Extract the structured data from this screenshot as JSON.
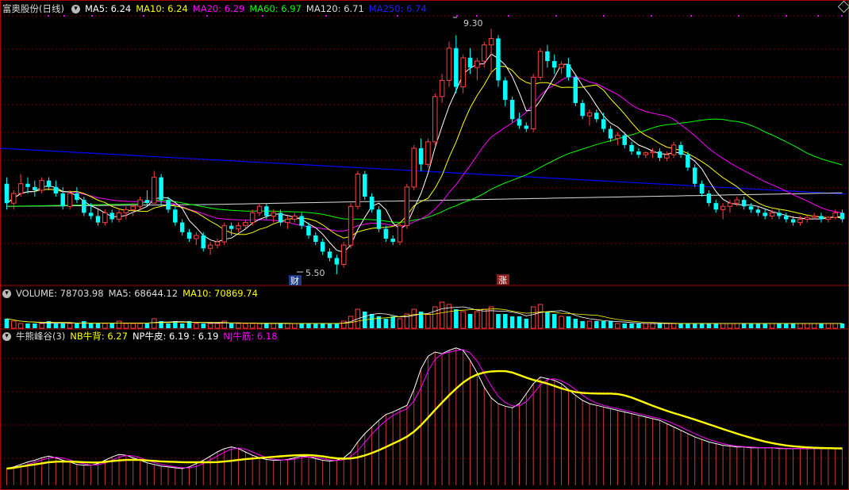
{
  "colors": {
    "up": "#ff4040",
    "down": "#00ffff",
    "ma5": "#ffffff",
    "ma10": "#ffff00",
    "ma20": "#ff00ff",
    "ma60": "#00ff00",
    "ma120": "#dddddd",
    "ma250": "#0000ff",
    "grid": "#7a0000",
    "nb": "#ffff00",
    "np": "#ffffff",
    "nj": "#ff00ff"
  },
  "main_legend": {
    "title": "富奥股份(日线)",
    "items": [
      {
        "text": "MA5: 6.24",
        "color": "#ffffff"
      },
      {
        "text": "MA10: 6.24",
        "color": "#ffff00"
      },
      {
        "text": "MA20: 6.29",
        "color": "#ff00ff"
      },
      {
        "text": "MA60: 6.97",
        "color": "#00ff00"
      },
      {
        "text": "MA120: 6.71",
        "color": "#dddddd"
      },
      {
        "text": "MA250: 6.74",
        "color": "#2020ff"
      }
    ]
  },
  "volume_legend": {
    "items": [
      {
        "text": "VOLUME: 78703.98",
        "color": "#dddddd"
      },
      {
        "text": "MA5: 68644.12",
        "color": "#dddddd"
      },
      {
        "text": "MA10: 70869.74",
        "color": "#ffff00"
      }
    ]
  },
  "osc_legend": {
    "items": [
      {
        "text": "牛熊峰谷(3)",
        "color": "#dddddd"
      },
      {
        "text": "NB牛背: 6.27",
        "color": "#ffff00"
      },
      {
        "text": "NP牛皮: 6.19 : 6.19",
        "color": "#ffffff"
      },
      {
        "text": "NJ牛筋: 6.18",
        "color": "#ff00ff"
      }
    ]
  },
  "annotations": {
    "high_label": "9.30",
    "low_label": "5.50",
    "badge_cai": "财",
    "badge_zhang": "涨"
  },
  "chart_data": [
    {
      "type": "candlestick",
      "title": "富奥股份(日线)",
      "ylim": [
        5.35,
        9.5
      ],
      "high": 9.3,
      "low": 5.5,
      "ohlc": [
        [
          6.9,
          7.0,
          6.5,
          6.6
        ],
        [
          6.6,
          6.8,
          6.5,
          6.75
        ],
        [
          6.75,
          7.05,
          6.7,
          6.9
        ],
        [
          6.9,
          7.0,
          6.75,
          6.85
        ],
        [
          6.85,
          6.95,
          6.7,
          6.8
        ],
        [
          6.8,
          7.0,
          6.75,
          6.95
        ],
        [
          6.95,
          7.0,
          6.8,
          6.85
        ],
        [
          6.85,
          6.95,
          6.7,
          6.75
        ],
        [
          6.75,
          6.85,
          6.5,
          6.55
        ],
        [
          6.55,
          6.8,
          6.5,
          6.75
        ],
        [
          6.75,
          6.85,
          6.6,
          6.65
        ],
        [
          6.65,
          6.7,
          6.4,
          6.45
        ],
        [
          6.45,
          6.6,
          6.35,
          6.4
        ],
        [
          6.4,
          6.5,
          6.25,
          6.3
        ],
        [
          6.3,
          6.5,
          6.25,
          6.45
        ],
        [
          6.45,
          6.5,
          6.3,
          6.35
        ],
        [
          6.35,
          6.5,
          6.3,
          6.45
        ],
        [
          6.45,
          6.55,
          6.35,
          6.5
        ],
        [
          6.5,
          6.6,
          6.4,
          6.55
        ],
        [
          6.55,
          6.7,
          6.5,
          6.65
        ],
        [
          6.65,
          6.8,
          6.55,
          6.6
        ],
        [
          6.6,
          7.1,
          6.6,
          7.0
        ],
        [
          7.0,
          7.05,
          6.55,
          6.65
        ],
        [
          6.65,
          6.7,
          6.45,
          6.5
        ],
        [
          6.5,
          6.55,
          6.25,
          6.3
        ],
        [
          6.3,
          6.35,
          6.1,
          6.15
        ],
        [
          6.15,
          6.2,
          6.0,
          6.05
        ],
        [
          6.05,
          6.15,
          5.95,
          6.1
        ],
        [
          6.1,
          6.15,
          5.85,
          5.9
        ],
        [
          5.9,
          6.0,
          5.8,
          5.95
        ],
        [
          5.95,
          6.05,
          5.9,
          6.0
        ],
        [
          6.0,
          6.3,
          5.95,
          6.25
        ],
        [
          6.25,
          6.3,
          6.1,
          6.2
        ],
        [
          6.2,
          6.3,
          6.15,
          6.25
        ],
        [
          6.25,
          6.35,
          6.2,
          6.3
        ],
        [
          6.3,
          6.5,
          6.25,
          6.45
        ],
        [
          6.45,
          6.6,
          6.4,
          6.55
        ],
        [
          6.55,
          6.6,
          6.35,
          6.4
        ],
        [
          6.4,
          6.5,
          6.3,
          6.45
        ],
        [
          6.45,
          6.5,
          6.25,
          6.3
        ],
        [
          6.3,
          6.4,
          6.2,
          6.35
        ],
        [
          6.35,
          6.45,
          6.3,
          6.4
        ],
        [
          6.4,
          6.45,
          6.2,
          6.25
        ],
        [
          6.25,
          6.3,
          6.05,
          6.1
        ],
        [
          6.1,
          6.15,
          5.95,
          6.0
        ],
        [
          6.0,
          6.05,
          5.8,
          5.85
        ],
        [
          5.85,
          5.9,
          5.7,
          5.75
        ],
        [
          5.75,
          5.8,
          5.5,
          5.65
        ],
        [
          5.65,
          6.0,
          5.6,
          5.95
        ],
        [
          5.95,
          6.6,
          5.9,
          6.55
        ],
        [
          6.55,
          7.1,
          6.5,
          7.05
        ],
        [
          7.05,
          7.1,
          6.65,
          6.7
        ],
        [
          6.7,
          6.75,
          6.45,
          6.5
        ],
        [
          6.5,
          6.55,
          6.15,
          6.2
        ],
        [
          6.2,
          6.25,
          6.0,
          6.05
        ],
        [
          6.05,
          6.1,
          5.95,
          6.0
        ],
        [
          6.0,
          6.3,
          5.95,
          6.25
        ],
        [
          6.25,
          6.9,
          6.2,
          6.85
        ],
        [
          6.85,
          7.5,
          6.8,
          7.45
        ],
        [
          7.45,
          7.6,
          7.1,
          7.2
        ],
        [
          7.2,
          7.6,
          7.15,
          7.55
        ],
        [
          7.55,
          8.3,
          7.5,
          8.25
        ],
        [
          8.25,
          8.6,
          8.15,
          8.5
        ],
        [
          8.5,
          9.1,
          8.4,
          9.0
        ],
        [
          9.0,
          9.2,
          8.3,
          8.4
        ],
        [
          8.4,
          8.9,
          8.3,
          8.85
        ],
        [
          8.85,
          9.0,
          8.6,
          8.7
        ],
        [
          8.7,
          8.85,
          8.5,
          8.8
        ],
        [
          8.8,
          9.1,
          8.7,
          9.05
        ],
        [
          9.05,
          9.3,
          8.6,
          9.15
        ],
        [
          9.15,
          9.2,
          8.4,
          8.5
        ],
        [
          8.5,
          8.55,
          8.1,
          8.2
        ],
        [
          8.2,
          8.25,
          7.85,
          7.9
        ],
        [
          7.9,
          8.0,
          7.75,
          7.8
        ],
        [
          7.8,
          7.85,
          7.7,
          7.75
        ],
        [
          7.75,
          8.6,
          7.7,
          8.55
        ],
        [
          8.55,
          9.0,
          8.5,
          8.95
        ],
        [
          8.95,
          9.05,
          8.7,
          8.8
        ],
        [
          8.8,
          8.9,
          8.6,
          8.7
        ],
        [
          8.7,
          8.8,
          8.6,
          8.75
        ],
        [
          8.75,
          8.85,
          8.5,
          8.55
        ],
        [
          8.55,
          8.6,
          8.1,
          8.15
        ],
        [
          8.15,
          8.2,
          7.9,
          7.95
        ],
        [
          7.95,
          8.05,
          7.8,
          8.0
        ],
        [
          8.0,
          8.05,
          7.85,
          7.9
        ],
        [
          7.9,
          8.0,
          7.7,
          7.75
        ],
        [
          7.75,
          7.8,
          7.55,
          7.6
        ],
        [
          7.6,
          7.7,
          7.5,
          7.65
        ],
        [
          7.65,
          7.7,
          7.45,
          7.5
        ],
        [
          7.5,
          7.55,
          7.35,
          7.4
        ],
        [
          7.4,
          7.45,
          7.3,
          7.35
        ],
        [
          7.35,
          7.4,
          7.3,
          7.38
        ],
        [
          7.38,
          7.45,
          7.3,
          7.4
        ],
        [
          7.4,
          7.45,
          7.25,
          7.3
        ],
        [
          7.3,
          7.4,
          7.25,
          7.35
        ],
        [
          7.35,
          7.55,
          7.3,
          7.5
        ],
        [
          7.5,
          7.55,
          7.3,
          7.35
        ],
        [
          7.35,
          7.4,
          7.1,
          7.15
        ],
        [
          7.15,
          7.2,
          6.85,
          6.9
        ],
        [
          6.9,
          6.95,
          6.7,
          6.75
        ],
        [
          6.75,
          6.8,
          6.55,
          6.6
        ],
        [
          6.6,
          6.65,
          6.45,
          6.5
        ],
        [
          6.5,
          6.6,
          6.35,
          6.55
        ],
        [
          6.55,
          6.65,
          6.45,
          6.6
        ],
        [
          6.6,
          6.7,
          6.55,
          6.65
        ],
        [
          6.65,
          6.7,
          6.5,
          6.55
        ],
        [
          6.55,
          6.6,
          6.45,
          6.5
        ],
        [
          6.5,
          6.55,
          6.4,
          6.45
        ],
        [
          6.45,
          6.5,
          6.35,
          6.4
        ],
        [
          6.4,
          6.5,
          6.35,
          6.45
        ],
        [
          6.45,
          6.5,
          6.35,
          6.4
        ],
        [
          6.4,
          6.45,
          6.3,
          6.35
        ],
        [
          6.35,
          6.4,
          6.25,
          6.3
        ],
        [
          6.3,
          6.4,
          6.25,
          6.35
        ],
        [
          6.35,
          6.4,
          6.3,
          6.38
        ],
        [
          6.38,
          6.45,
          6.35,
          6.4
        ],
        [
          6.4,
          6.45,
          6.3,
          6.35
        ],
        [
          6.35,
          6.4,
          6.3,
          6.38
        ],
        [
          6.38,
          6.5,
          6.35,
          6.45
        ],
        [
          6.45,
          6.5,
          6.3,
          6.35
        ]
      ],
      "ma250": [
        7.45,
        6.74
      ]
    },
    {
      "type": "bar",
      "name": "VOLUME",
      "values": [
        4,
        3,
        2,
        2,
        2,
        2,
        3,
        2,
        2,
        2,
        2,
        3,
        2,
        2,
        2,
        2,
        3,
        2,
        2,
        2,
        2,
        4,
        3,
        2,
        3,
        2,
        3,
        2,
        2,
        2,
        2,
        3,
        2,
        2,
        2,
        2,
        2,
        2,
        2,
        2,
        2,
        2,
        2,
        2,
        2,
        2,
        2,
        2,
        3,
        5,
        8,
        7,
        6,
        5,
        4,
        5,
        4,
        6,
        8,
        7,
        6,
        9,
        11,
        10,
        8,
        7,
        6,
        7,
        8,
        9,
        6,
        6,
        5,
        5,
        4,
        9,
        10,
        7,
        6,
        5,
        5,
        4,
        3,
        3,
        3,
        3,
        3,
        2,
        2,
        2,
        2,
        2,
        2,
        2,
        2,
        2,
        2,
        2,
        2,
        2,
        2,
        2,
        2,
        2,
        2,
        2,
        2,
        2,
        2,
        2,
        2,
        2,
        2,
        2,
        2,
        2,
        2,
        2,
        2,
        2
      ]
    },
    {
      "type": "bar",
      "name": "牛熊峰谷(3)",
      "values": [
        20,
        22,
        25,
        28,
        30,
        33,
        35,
        33,
        30,
        28,
        25,
        24,
        24,
        26,
        30,
        34,
        37,
        36,
        33,
        30,
        27,
        25,
        23,
        22,
        21,
        20,
        22,
        26,
        30,
        35,
        40,
        44,
        46,
        44,
        40,
        36,
        33,
        31,
        30,
        30,
        31,
        33,
        35,
        34,
        32,
        30,
        29,
        30,
        33,
        40,
        52,
        62,
        70,
        78,
        85,
        88,
        92,
        96,
        115,
        140,
        155,
        160,
        158,
        162,
        165,
        162,
        150,
        135,
        118,
        105,
        98,
        95,
        93,
        98,
        110,
        122,
        130,
        128,
        126,
        122,
        115,
        108,
        102,
        98,
        96,
        94,
        92,
        90,
        88,
        86,
        84,
        82,
        80,
        78,
        74,
        70,
        66,
        62,
        58,
        55,
        52,
        50,
        48,
        47,
        46,
        46,
        45,
        45,
        45,
        45,
        44,
        44,
        44,
        44,
        44,
        44,
        44,
        44,
        44,
        44
      ]
    }
  ]
}
